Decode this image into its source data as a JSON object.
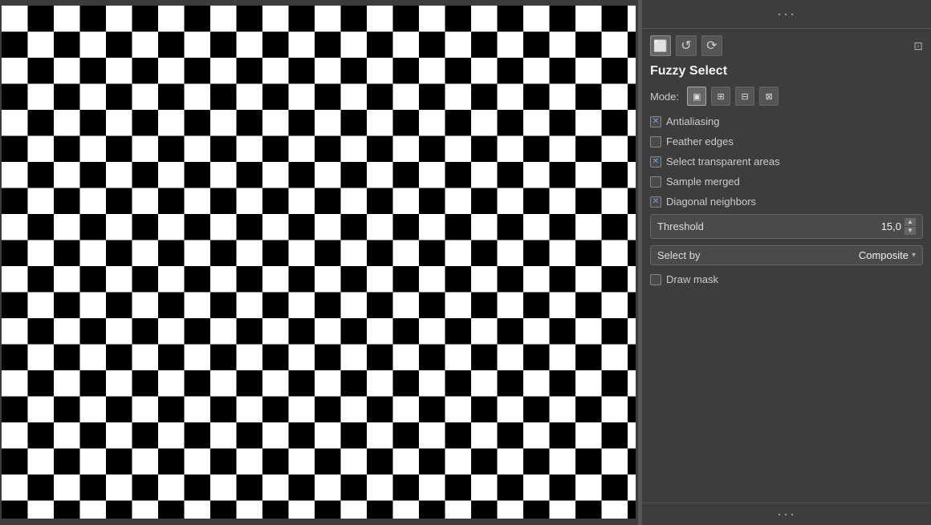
{
  "panel": {
    "title": "Fuzzy Select",
    "top_dots": "···",
    "bottom_dots": "···",
    "expand_icon": "⊡",
    "mode_label": "Mode:",
    "mode_buttons": [
      {
        "id": "replace",
        "icon": "▣",
        "active": true
      },
      {
        "id": "add",
        "icon": "⊞",
        "active": false
      },
      {
        "id": "subtract",
        "icon": "⊟",
        "active": false
      },
      {
        "id": "intersect",
        "icon": "⊠",
        "active": false
      }
    ],
    "checkboxes": [
      {
        "id": "antialiasing",
        "label": "Antialiasing",
        "checked": true
      },
      {
        "id": "feather-edges",
        "label": "Feather edges",
        "checked": false
      },
      {
        "id": "select-transparent",
        "label": "Select transparent areas",
        "checked": true
      },
      {
        "id": "sample-merged",
        "label": "Sample merged",
        "checked": false
      },
      {
        "id": "diagonal-neighbors",
        "label": "Diagonal neighbors",
        "checked": true
      }
    ],
    "threshold": {
      "label": "Threshold",
      "value": "15,0"
    },
    "select_by": {
      "label": "Select by",
      "value": "Composite"
    },
    "draw_mask": {
      "label": "Draw mask",
      "checked": false
    }
  },
  "tool_icons": [
    {
      "id": "select-rect",
      "icon": "⬜"
    },
    {
      "id": "select-fuzzy",
      "icon": "↺"
    },
    {
      "id": "select-path",
      "icon": "⟳"
    }
  ]
}
